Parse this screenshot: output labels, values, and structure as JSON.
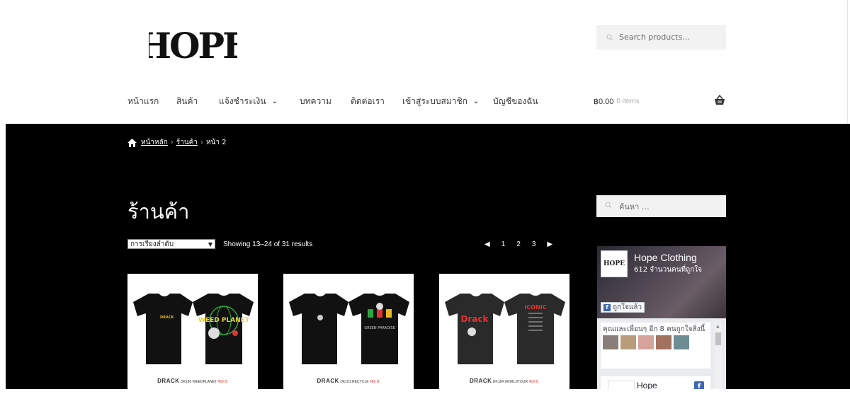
{
  "header": {
    "logo_text": "HOPE",
    "search_placeholder": "Search products…"
  },
  "nav": {
    "items": [
      {
        "label": "หน้าแรก",
        "has_dropdown": false
      },
      {
        "label": "สินค้า",
        "has_dropdown": false
      },
      {
        "label": "แจ้งชำระเงิน",
        "has_dropdown": true
      },
      {
        "label": "บทความ",
        "has_dropdown": false
      },
      {
        "label": "ติดต่อเรา",
        "has_dropdown": false
      },
      {
        "label": "เข้าสู่ระบบสมาชิก",
        "has_dropdown": true
      },
      {
        "label": "บัญชีของฉัน",
        "has_dropdown": false
      }
    ]
  },
  "cart": {
    "total": "฿0.00",
    "items": "0 items",
    "icon": "basket-icon"
  },
  "breadcrumb": {
    "home_icon": "home-icon",
    "home": "หน้าหลัก",
    "shop": "ร้านค้า",
    "current": "หน้า 2",
    "separator": "›"
  },
  "shop": {
    "title": "ร้านค้า",
    "sort_label": "การเรียงลำดับ",
    "result_count": "Showing 13–24 of 31 results",
    "pagination": {
      "prev_icon": "chevron-left-icon",
      "pages": [
        "1",
        "2",
        "3"
      ],
      "next_icon": "chevron-right-icon"
    }
  },
  "products": [
    {
      "brand": "DRACK",
      "code": "DK180 WEEDPLANET",
      "price": "450 B.",
      "front_graphic": "DRACK",
      "back_graphic": "WEED PLANET"
    },
    {
      "brand": "DRACK",
      "code": "DK181 RECYCLE",
      "price": "450 B.",
      "front_graphic": "",
      "back_graphic": "GREEN PARADISE"
    },
    {
      "brand": "DRACK",
      "code": "DK184 WORLDTOUR",
      "price": "450 B.",
      "front_graphic": "Drack",
      "back_graphic": "ICONIC"
    }
  ],
  "sidebar": {
    "search_placeholder": "ค้นหา …",
    "facebook": {
      "page_name": "Hope Clothing",
      "likes": "612 จำนวนคนที่ถูกใจ",
      "liked_button": "ถูกใจแล้ว",
      "friends_text": "คุณและเพื่อนๆ อีก 8 คนถูกใจสิ่งนี้",
      "thumb_text": "HOPE",
      "next_post_name": "Hope",
      "fb_icon": "f"
    }
  },
  "colors": {
    "band": "#000000",
    "price": "#d33333",
    "facebook": "#4267b2"
  }
}
